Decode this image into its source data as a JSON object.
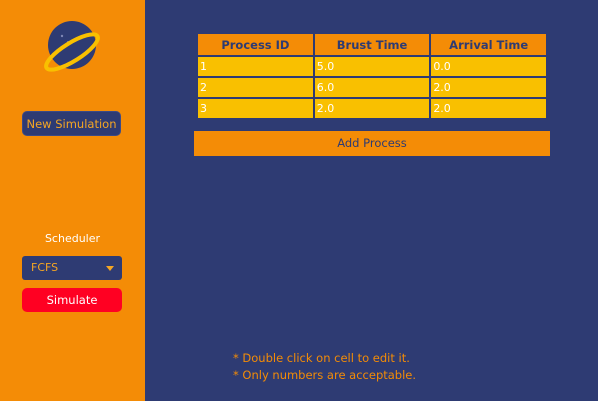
{
  "sidebar": {
    "new_simulation_label": "New Simulation",
    "scheduler_label": "Scheduler",
    "scheduler_selected": "FCFS",
    "simulate_label": "Simulate"
  },
  "table": {
    "headers": [
      "Process ID",
      "Brust Time",
      "Arrival Time"
    ],
    "rows": [
      [
        "1",
        "5.0",
        "0.0"
      ],
      [
        "2",
        "6.0",
        "2.0"
      ],
      [
        "3",
        "2.0",
        "2.0"
      ]
    ]
  },
  "add_process_label": "Add Process",
  "notes": [
    "* Double click on cell to edit it.",
    "* Only numbers are acceptable."
  ],
  "colors": {
    "sidebar_bg": "#f48c06",
    "main_bg": "#2e3b73",
    "cell_bg": "#f9c000",
    "simulate_bg": "#ff0022",
    "accent_text": "#f5a623"
  },
  "icons": {
    "logo": "planet-logo-icon",
    "dropdown": "caret-down-icon"
  }
}
